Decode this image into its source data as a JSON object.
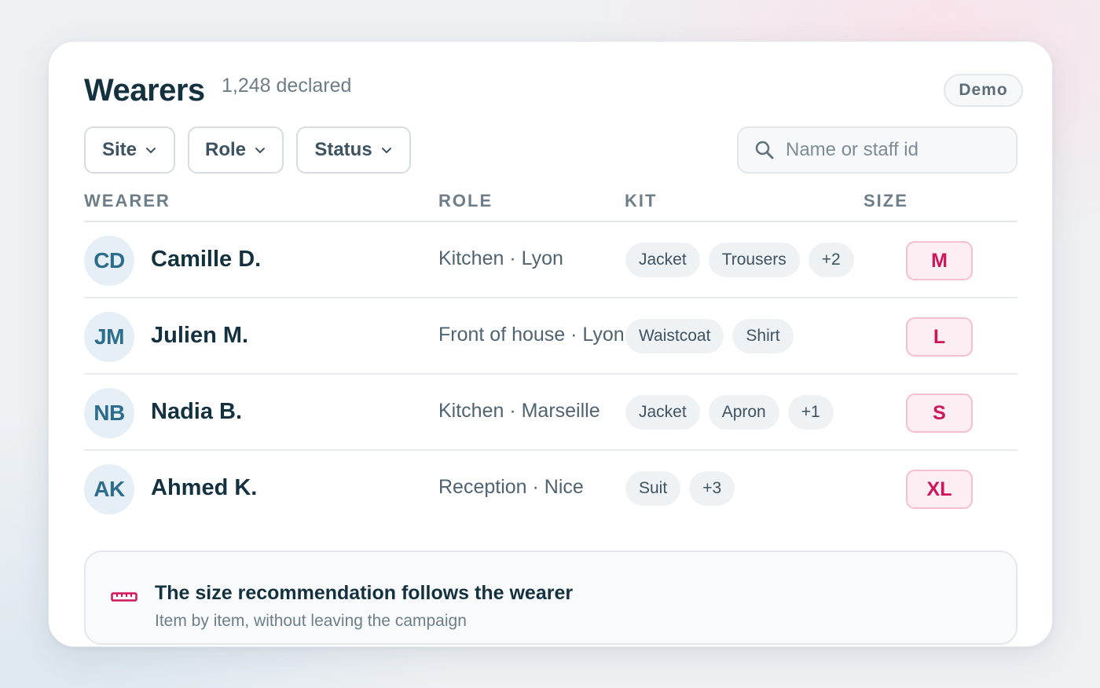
{
  "header": {
    "title": "Wearers",
    "count": "1,248 declared",
    "badge": "Demo"
  },
  "filters": [
    {
      "label": "Site"
    },
    {
      "label": "Role"
    },
    {
      "label": "Status"
    }
  ],
  "search": {
    "placeholder": "Name or staff id",
    "icon": "search-icon"
  },
  "table": {
    "columns": [
      "WEARER",
      "ROLE",
      "KIT",
      "SIZE"
    ],
    "rows": [
      {
        "initials": "CD",
        "name": "Camille D.",
        "role": "Kitchen · Lyon",
        "kit": [
          "Jacket",
          "Trousers",
          "+2"
        ],
        "size": "M"
      },
      {
        "initials": "JM",
        "name": "Julien M.",
        "role": "Front of house · Lyon",
        "kit": [
          "Waistcoat",
          "Shirt"
        ],
        "size": "L"
      },
      {
        "initials": "NB",
        "name": "Nadia B.",
        "role": "Kitchen · Marseille",
        "kit": [
          "Jacket",
          "Apron",
          "+1"
        ],
        "size": "S"
      },
      {
        "initials": "AK",
        "name": "Ahmed K.",
        "role": "Reception · Nice",
        "kit": [
          "Suit",
          "+3"
        ],
        "size": "XL"
      }
    ]
  },
  "footer": {
    "icon": "ruler-icon",
    "title": "The size recommendation follows the wearer",
    "subtitle": "Item by item, without leaving the campaign"
  },
  "colors": {
    "accent": "#d0155b",
    "text_primary": "#14313f",
    "avatar_text": "#2c6d8e"
  }
}
